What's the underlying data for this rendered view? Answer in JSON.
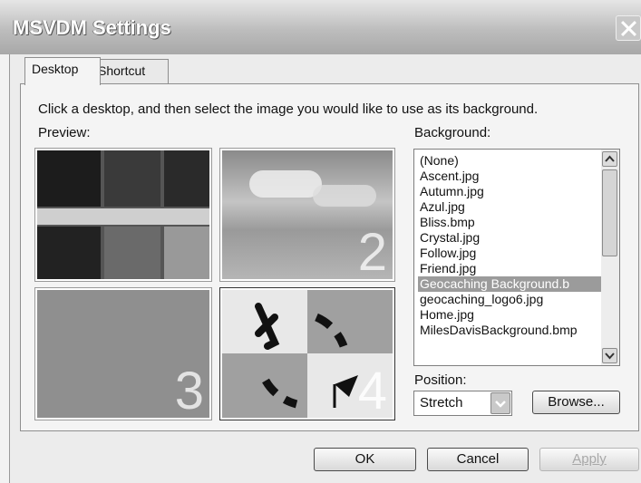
{
  "window": {
    "title": "MSVDM Settings"
  },
  "tabs": [
    "Desktop",
    "Shortcut Keys"
  ],
  "instruction": "Click a desktop, and then select the image you would like to use as its background.",
  "preview_label": "Preview:",
  "background_label": "Background:",
  "desktops": [
    "2",
    "3",
    "4"
  ],
  "background_list": {
    "items": [
      "(None)",
      "Ascent.jpg",
      "Autumn.jpg",
      "Azul.jpg",
      "Bliss.bmp",
      "Crystal.jpg",
      "Follow.jpg",
      "Friend.jpg",
      "Geocaching Background.b",
      "geocaching_logo6.jpg",
      "Home.jpg",
      "MilesDavisBackground.bmp"
    ],
    "selected": "Geocaching Background.b"
  },
  "position": {
    "label": "Position:",
    "value": "Stretch"
  },
  "buttons": {
    "browse": "Browse...",
    "ok": "OK",
    "cancel": "Cancel",
    "apply": "Apply"
  }
}
